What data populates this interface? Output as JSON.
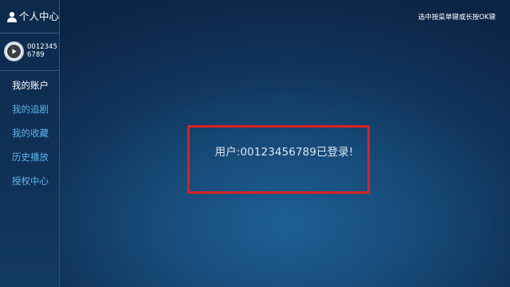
{
  "sidebar": {
    "title": "个人中心",
    "profile": {
      "user_id": "00123456789"
    },
    "items": [
      {
        "label": "我的账户",
        "active": true
      },
      {
        "label": "我的追剧",
        "active": false
      },
      {
        "label": "我的收藏",
        "active": false
      },
      {
        "label": "历史播放",
        "active": false
      },
      {
        "label": "授权中心",
        "active": false
      }
    ]
  },
  "hint": "选中按菜单键或长按OK键",
  "main": {
    "message": "用户:00123456789已登录!"
  },
  "colors": {
    "accent": "#5fb4ec",
    "highlight_border": "#d92222",
    "background": "#174a78"
  },
  "icons": {
    "header": "user-icon",
    "avatar": "play-icon"
  }
}
